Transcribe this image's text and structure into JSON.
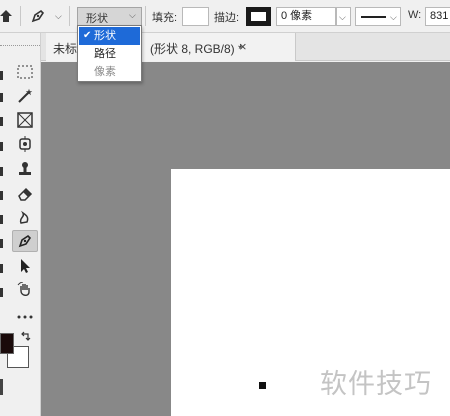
{
  "options_bar": {
    "tool_mode": {
      "value": "形状"
    },
    "fill_label": "填充:",
    "stroke_label": "描边:",
    "stroke_width": "0 像素",
    "width_label": "W:",
    "width_value": "831"
  },
  "mode_dropdown": {
    "options": [
      {
        "label": "形状",
        "checkmark": "✔",
        "selected": true
      },
      {
        "label": "路径",
        "selected": false
      },
      {
        "label": "像素",
        "selected": false,
        "disabled": true
      }
    ]
  },
  "document_tab": {
    "title": "未标",
    "suffix": "(形状 8, RGB/8) *",
    "close": "×"
  },
  "canvas": {
    "workspace_color": "#888888",
    "document_color": "#ffffff"
  },
  "watermark": "软件技巧",
  "colors": {
    "foreground": "#1a0a0a",
    "background": "#ffffff",
    "highlight": "#1e6ad8"
  },
  "tools": [
    "rectangular-marquee-icon",
    "magic-wand-icon",
    "frame-icon",
    "stamp-icon",
    "clone-stamp-icon",
    "eraser-icon",
    "smudge-icon",
    "pen-icon",
    "path-selection-icon",
    "hand-rotate-icon",
    "more-tools-icon"
  ]
}
